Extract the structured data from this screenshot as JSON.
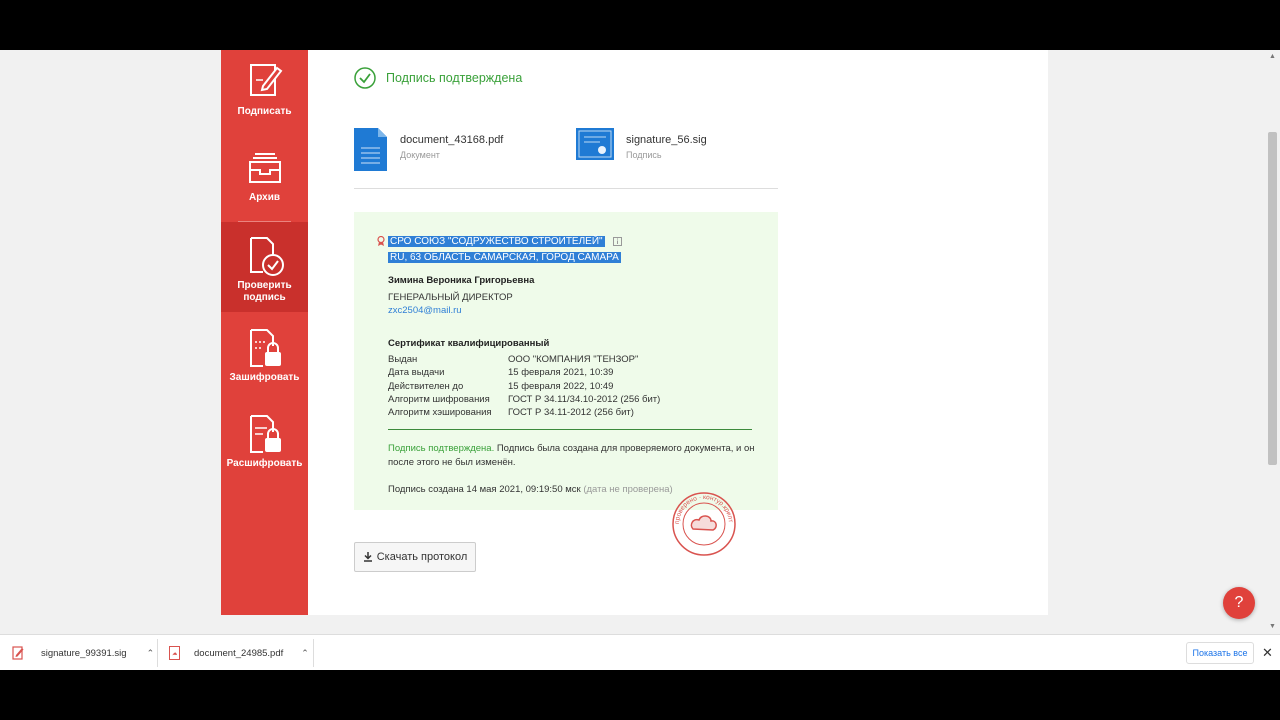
{
  "sidebar": {
    "items": [
      {
        "label": "Подписать",
        "icon": "sign-icon"
      },
      {
        "label": "Архив",
        "icon": "archive-icon"
      },
      {
        "label": "Проверить подпись",
        "icon": "verify-icon",
        "active": true
      },
      {
        "label": "Зашифровать",
        "icon": "encrypt-icon"
      },
      {
        "label": "Расшифровать",
        "icon": "decrypt-icon"
      }
    ]
  },
  "status": {
    "text": "Подпись подтверждена"
  },
  "files": [
    {
      "name": "document_43168.pdf",
      "type": "Документ"
    },
    {
      "name": "signature_56.sig",
      "type": "Подпись"
    }
  ],
  "certificate": {
    "org": "СРО СОЮЗ \"СОДРУЖЕСТВО СТРОИТЕЛЕЙ\"",
    "location": "RU, 63 ОБЛАСТЬ САМАРСКАЯ, ГОРОД САМАРА",
    "person": "Зимина Вероника Григорьевна",
    "role": "ГЕНЕРАЛЬНЫЙ ДИРЕКТОР",
    "email": "zxc2504@mail.ru",
    "title": "Сертификат квалифицированный",
    "rows": [
      {
        "key": "Выдан",
        "value": "ООО \"КОМПАНИЯ \"ТЕНЗОР\""
      },
      {
        "key": "Дата выдачи",
        "value": "15 февраля 2021, 10:39"
      },
      {
        "key": "Действителен до",
        "value": "15 февраля 2022, 10:49"
      },
      {
        "key": "Алгоритм шифрования",
        "value": "ГОСТ Р 34.11/34.10-2012 (256 бит)"
      },
      {
        "key": "Алгоритм хэширования",
        "value": "ГОСТ Р 34.11-2012 (256 бит)"
      }
    ],
    "note_ok": "Подпись подтверждена.",
    "note_rest": " Подпись была создана для проверяемого документа, и он после этого не был изменён.",
    "created": "Подпись создана 14 мая 2021, 09:19:50 мск",
    "created_note": "(дата не проверена)"
  },
  "stamp": {
    "text": "проверено · контур.крипто"
  },
  "download_button": {
    "label": "Скачать протокол"
  },
  "help": {
    "label": "?"
  },
  "download_bar": {
    "items": [
      {
        "name": "signature_99391.sig"
      },
      {
        "name": "document_24985.pdf"
      }
    ],
    "show_all": "Показать все",
    "close": "✕"
  },
  "colors": {
    "brand": "#e0413b",
    "success": "#3aa13a",
    "link": "#2f7fd6"
  }
}
